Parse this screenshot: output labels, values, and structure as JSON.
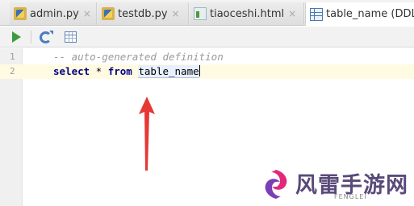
{
  "tabs": [
    {
      "label": "admin.py",
      "icon": "python-file-icon",
      "closable": true
    },
    {
      "label": "testdb.py",
      "icon": "python-file-icon",
      "closable": true
    },
    {
      "label": "tiaoceshi.html",
      "icon": "html-file-icon",
      "closable": true
    },
    {
      "label": "table_name (DDL",
      "icon": "table-icon",
      "active": true
    }
  ],
  "close_glyph": "×",
  "toolbar": {
    "buttons": [
      "run-icon",
      "refresh-icon",
      "table-view-icon"
    ]
  },
  "editor": {
    "lines": [
      {
        "number": "1",
        "comment": "-- auto-generated definition"
      },
      {
        "number": "2",
        "kw_select": "select",
        "star": " * ",
        "kw_from": "from",
        "space": " ",
        "identifier": "table_name"
      }
    ],
    "current_line": 2
  },
  "colors": {
    "keyword": "#000080",
    "comment": "#9a9a9a",
    "current_line_bg": "#fffbe3",
    "arrow": "#e53935"
  },
  "watermark": {
    "text": "风雷手游网",
    "subtext": "FENGLEI"
  }
}
